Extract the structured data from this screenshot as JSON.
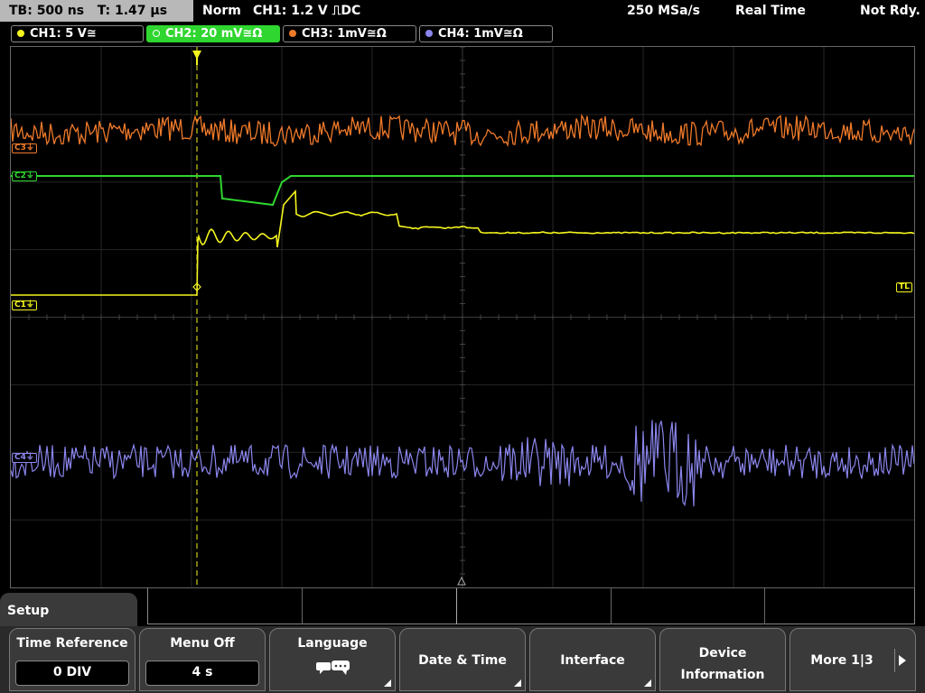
{
  "status": {
    "timebase": "TB: 500 ns   T: 1.47 µs",
    "mode": "Norm",
    "trigger": "CH1: 1.2 V ⎍DC",
    "sample_rate": "250 MSa/s",
    "acq_mode": "Real Time",
    "state": "Not Rdy."
  },
  "channels": [
    {
      "label": "CH1: 5 V≅",
      "color": "#f5f51e"
    },
    {
      "label": "CH2: 20 mV≅Ω",
      "color": "#2fd62f"
    },
    {
      "label": "CH3: 1mV≅Ω",
      "color": "#f07a2a"
    },
    {
      "label": "CH4: 1mV≅Ω",
      "color": "#8b86ee"
    }
  ],
  "markers": {
    "c3": "C3⏚",
    "c2": "C2⏚",
    "c1": "C1⏚",
    "c4": "C4⏚",
    "tl": "TL"
  },
  "menu": {
    "title": "Setup",
    "softkeys": [
      {
        "label": "Time Reference",
        "value": "0 DIV"
      },
      {
        "label": "Menu Off",
        "value": "4 s"
      },
      {
        "label": "Language"
      },
      {
        "label": "Date & Time"
      },
      {
        "label": "Interface"
      },
      {
        "label": "Device\nInformation"
      },
      {
        "label": "More 1|3"
      }
    ]
  },
  "icons": {
    "language": "speech-bubbles-icon",
    "trigger_marker": "trigger-position-icon",
    "more": "right-arrow-icon"
  }
}
